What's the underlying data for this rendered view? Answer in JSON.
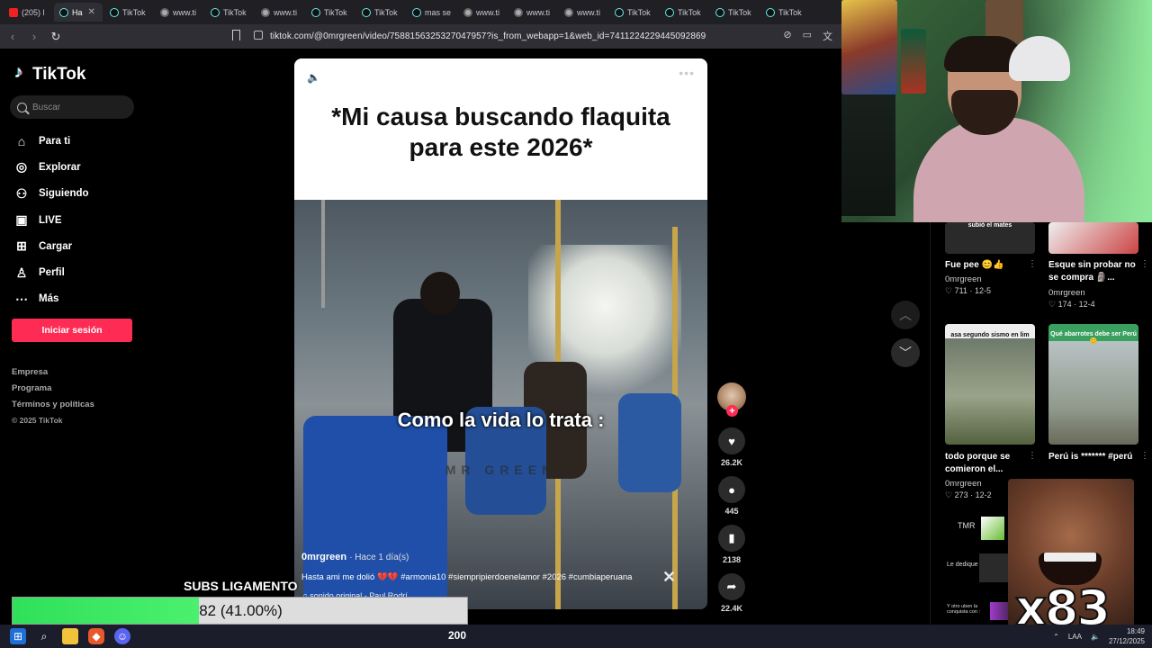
{
  "browser": {
    "tabs": [
      {
        "label": "(205) l",
        "icon": "youtube-icon"
      },
      {
        "label": "Ha",
        "icon": "tiktok-icon",
        "active": true
      },
      {
        "label": "TikTok",
        "icon": "tiktok-icon"
      },
      {
        "label": "www.ti",
        "icon": "globe-icon"
      },
      {
        "label": "TikTok",
        "icon": "tiktok-icon"
      },
      {
        "label": "www.ti",
        "icon": "globe-icon"
      },
      {
        "label": "TikTok",
        "icon": "tiktok-icon"
      },
      {
        "label": "TikTok",
        "icon": "tiktok-icon"
      },
      {
        "label": "mas se",
        "icon": "tiktok-icon"
      },
      {
        "label": "www.ti",
        "icon": "globe-icon"
      },
      {
        "label": "www.ti",
        "icon": "globe-icon"
      },
      {
        "label": "www.ti",
        "icon": "globe-icon"
      },
      {
        "label": "TikTok",
        "icon": "tiktok-icon"
      },
      {
        "label": "TikTok",
        "icon": "tiktok-icon"
      },
      {
        "label": "TikTok",
        "icon": "tiktok-icon"
      },
      {
        "label": "TikTok",
        "icon": "tiktok-icon"
      }
    ],
    "url": "tiktok.com/@0mrgreen/video/7588156325327047957?is_from_webapp=1&web_id=7411224229445092869"
  },
  "sidebar": {
    "logo": "TikTok",
    "search_placeholder": "Buscar",
    "items": [
      {
        "label": "Para ti",
        "icon": "home-icon"
      },
      {
        "label": "Explorar",
        "icon": "compass-icon"
      },
      {
        "label": "Siguiendo",
        "icon": "following-icon"
      },
      {
        "label": "LIVE",
        "icon": "live-icon"
      },
      {
        "label": "Cargar",
        "icon": "upload-icon"
      },
      {
        "label": "Perfil",
        "icon": "profile-icon"
      },
      {
        "label": "Más",
        "icon": "more-icon"
      }
    ],
    "login_label": "Iniciar sesión",
    "footer": [
      "Empresa",
      "Programa",
      "Términos y políticas"
    ],
    "copyright": "© 2025 TikTok"
  },
  "video": {
    "top_caption": "*Mi causa buscando flaquita para este 2026*",
    "center_caption": "Como la vida lo trata :",
    "watermark": "MR GREEN",
    "author": "0mrgreen",
    "time": "· Hace 1 día(s)",
    "description": "Hasta ami me dolió 💔💔 #armonia10 #siempripierdoenelamor #2026 #cumbiaperuana",
    "sound": "♫ sonido original - Paul Rodrí"
  },
  "actions": {
    "likes": "26.2K",
    "comments": "445",
    "saves": "2138",
    "shares": "22.4K"
  },
  "recommendations": [
    {
      "title": "Fue pee 😊👍",
      "user": "0mrgreen",
      "likes": "711",
      "date": "12-5",
      "thumb_text": "subió el mates"
    },
    {
      "title": "Esque sin probar no se compra 🗿...",
      "user": "0mrgreen",
      "likes": "174",
      "date": "12-4",
      "thumb_text": ""
    },
    {
      "title": "todo porque se comieron el...",
      "user": "0mrgreen",
      "likes": "273",
      "date": "12-2",
      "thumb_text": "asa segundo sismo en lim"
    },
    {
      "title": "Perú is ******* #perú",
      "user": "",
      "likes": "",
      "date": "",
      "thumb_text": "Qué abarrotes debe ser Perú 😊"
    }
  ],
  "extra_comments": [
    "TMR",
    "Le dedique :",
    "Y otro uben la conquista con :"
  ],
  "overlay": {
    "subs_label": "SUBS LIGAMENTO",
    "subs_text": "82 (41.00%)",
    "subs_fraction": 0.41,
    "meme_text": "x83"
  },
  "taskbar": {
    "counter": "200",
    "lang": "LAA",
    "time": "18:49",
    "date": "27/12/2025"
  }
}
